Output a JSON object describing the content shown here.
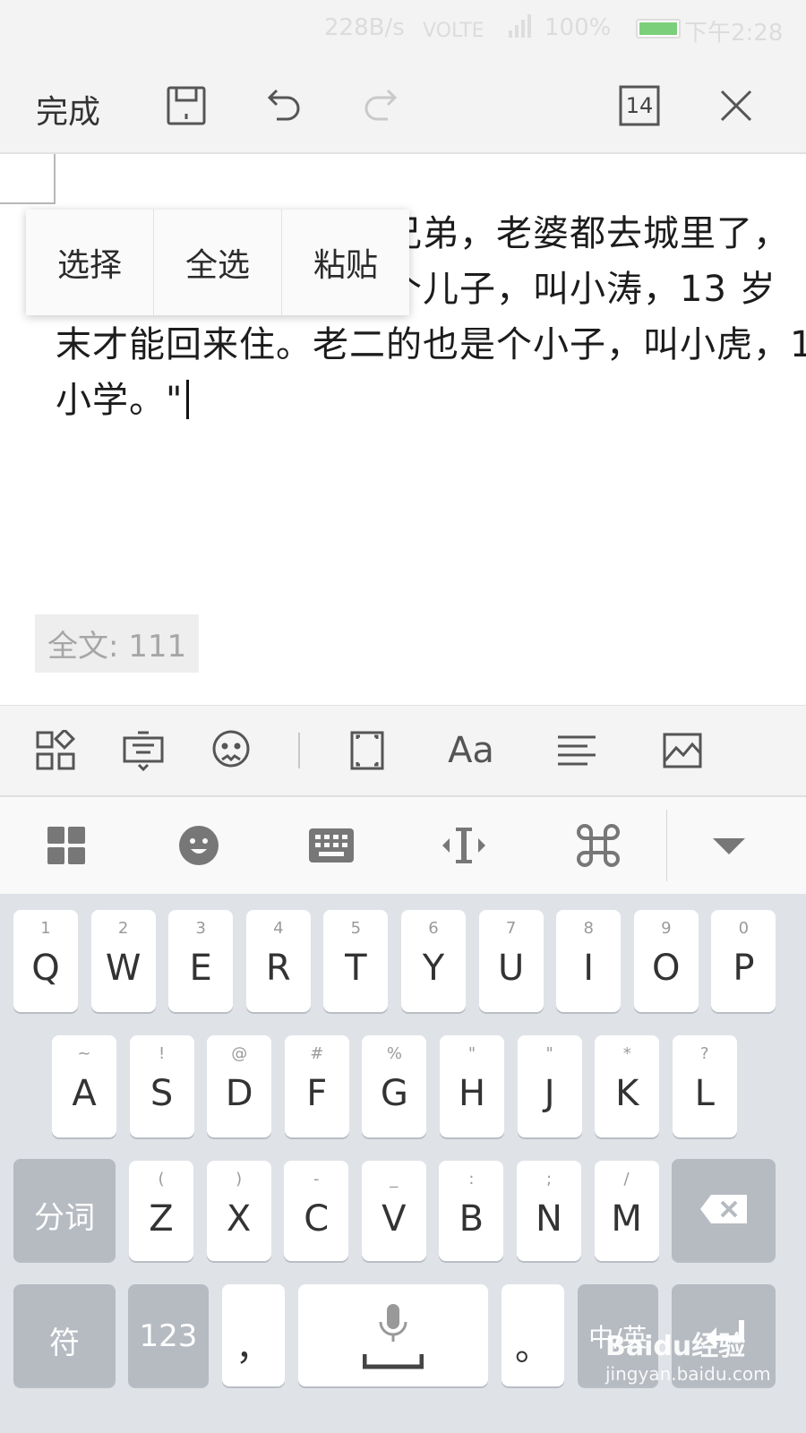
{
  "status_bar": {
    "speed": "228B/s",
    "volte": "VOLTE",
    "battery": "100%",
    "battery_level": 1.0,
    "time": "下午2:28"
  },
  "toolbar": {
    "done_label": "完成",
    "page_size": "14",
    "icons": [
      "save-icon",
      "undo-icon",
      "redo-icon",
      "font-size-icon",
      "close-icon"
    ]
  },
  "document": {
    "lines": [
      "村东头李家，兄弟两兄弟，老婆都去城里了，",
      "老大有两个儿子，有个儿子，叫小涛，13 岁",
      "末才能回来住。老二的也是个小子，叫小虎，1",
      "小学。\""
    ]
  },
  "context_menu": {
    "select": "选择",
    "select_all": "全选",
    "paste": "粘贴"
  },
  "word_count": "全文: 111",
  "format_bar": {
    "icons": [
      "grid-icon",
      "keyboard-icon",
      "emoji-icon",
      "crop-icon",
      "font-icon",
      "align-icon",
      "image-icon"
    ],
    "font_label": "Aa"
  },
  "ime_bar": {
    "icons": [
      "apps-icon",
      "smiley-icon",
      "keyboard-icon",
      "cursor-move-icon",
      "command-icon",
      "collapse-icon"
    ]
  },
  "keyboard": {
    "row1": [
      {
        "hint": "1",
        "key": "Q"
      },
      {
        "hint": "2",
        "key": "W"
      },
      {
        "hint": "3",
        "key": "E"
      },
      {
        "hint": "4",
        "key": "R"
      },
      {
        "hint": "5",
        "key": "T"
      },
      {
        "hint": "6",
        "key": "Y"
      },
      {
        "hint": "7",
        "key": "U"
      },
      {
        "hint": "8",
        "key": "I"
      },
      {
        "hint": "9",
        "key": "O"
      },
      {
        "hint": "0",
        "key": "P"
      }
    ],
    "row2": [
      {
        "hint": "~",
        "key": "A"
      },
      {
        "hint": "!",
        "key": "S"
      },
      {
        "hint": "@",
        "key": "D"
      },
      {
        "hint": "#",
        "key": "F"
      },
      {
        "hint": "%",
        "key": "G"
      },
      {
        "hint": "\"",
        "key": "H"
      },
      {
        "hint": "\"",
        "key": "J"
      },
      {
        "hint": "*",
        "key": "K"
      },
      {
        "hint": "?",
        "key": "L"
      }
    ],
    "row3": [
      {
        "hint": "(",
        "key": "Z"
      },
      {
        "hint": ")",
        "key": "X"
      },
      {
        "hint": "-",
        "key": "C"
      },
      {
        "hint": "_",
        "key": "V"
      },
      {
        "hint": ":",
        "key": "B"
      },
      {
        "hint": ";",
        "key": "N"
      },
      {
        "hint": "/",
        "key": "M"
      }
    ],
    "segment_label": "分词",
    "symbol_label": "符",
    "num_label": "123",
    "comma": "，",
    "period": "。",
    "lang_label": "中/英"
  },
  "watermark": {
    "brand": "Baidu经验",
    "url": "jingyan.baidu.com"
  }
}
